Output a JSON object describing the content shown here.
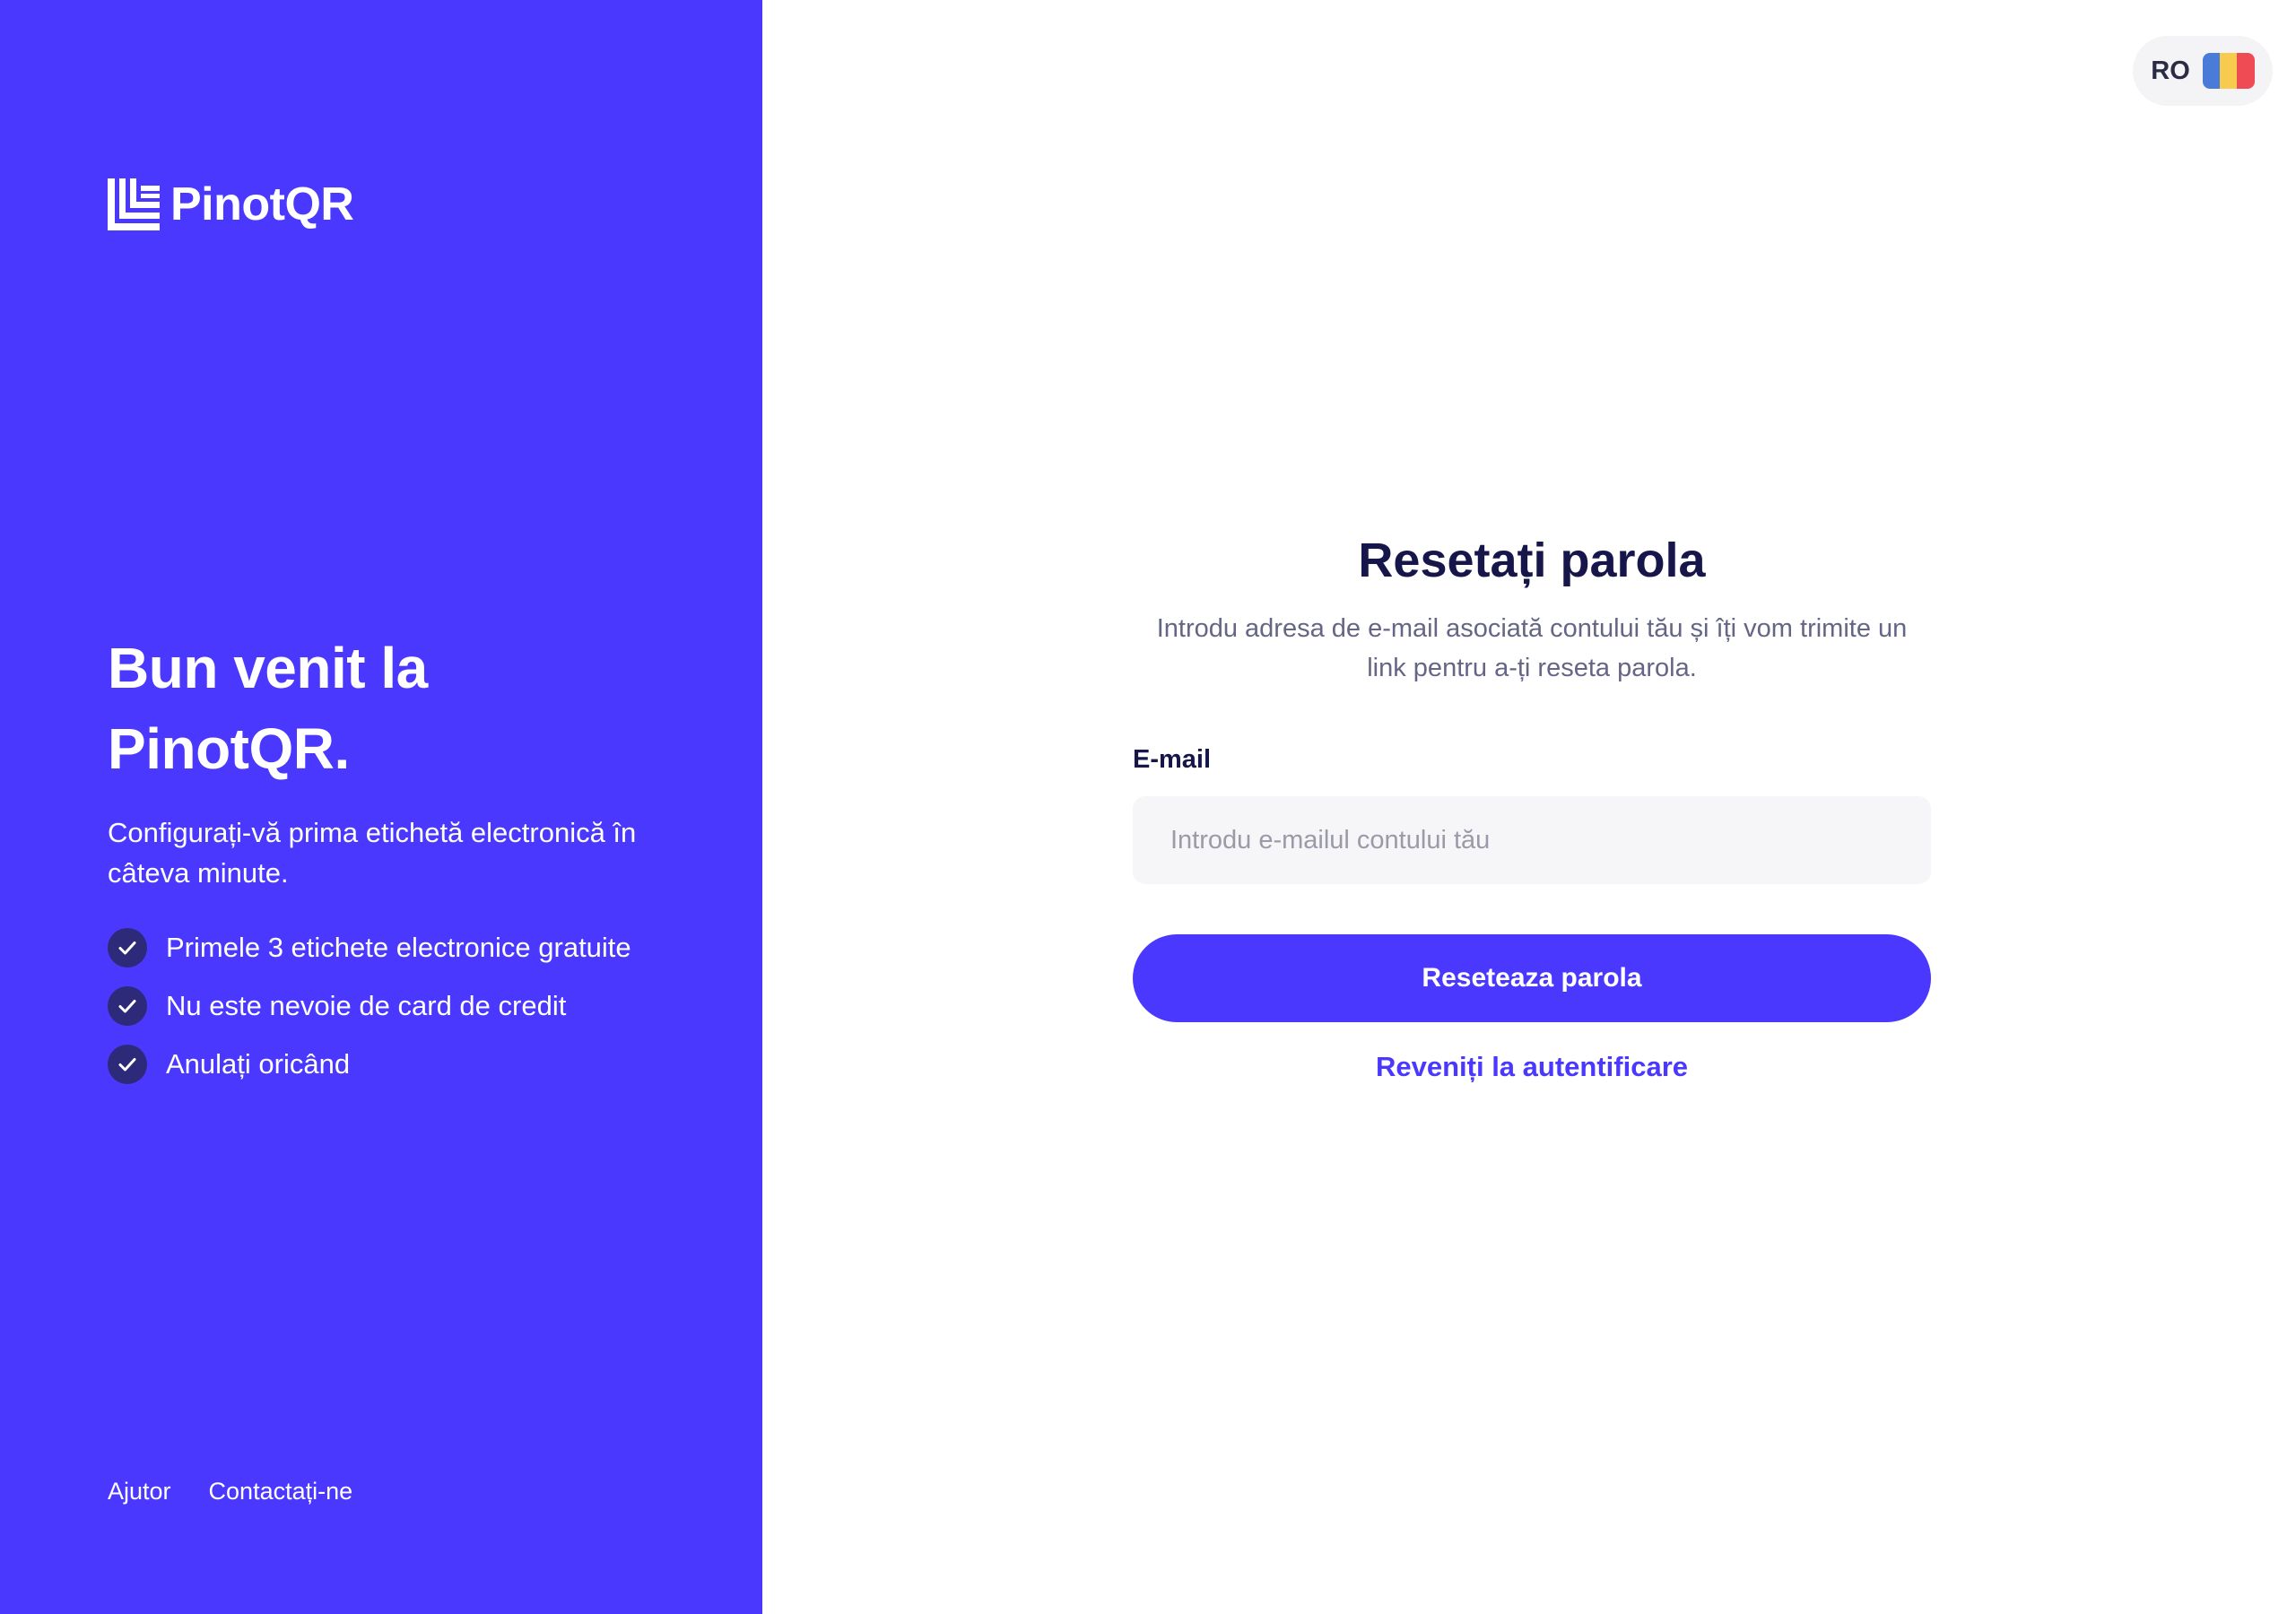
{
  "brand": {
    "name": "PinotQR",
    "accent_color": "#4a38fe",
    "logo_icon": "pinotqr-logo-icon"
  },
  "left_panel": {
    "welcome_title_line1": "Bun venit la",
    "welcome_title_line2": "PinotQR.",
    "subtitle": "Configurați-vă prima etichetă electronică în câteva minute.",
    "features": [
      {
        "icon": "check-icon",
        "label": "Primele 3 etichete electronice gratuite"
      },
      {
        "icon": "check-icon",
        "label": "Nu este nevoie de card de credit"
      },
      {
        "icon": "check-icon",
        "label": "Anulați oricând"
      }
    ],
    "footer_links": {
      "help": "Ajutor",
      "contact": "Contactați-ne"
    }
  },
  "language_selector": {
    "code": "RO",
    "flag_icon": "romania-flag-icon",
    "flag_colors": [
      "#4a7bd9",
      "#f7cb4d",
      "#ef4b55"
    ]
  },
  "form": {
    "title": "Resetați parola",
    "description": "Introdu adresa de e-mail asociată contului tău și îți vom trimite un link pentru a-ți reseta parola.",
    "email_label": "E-mail",
    "email_placeholder": "Introdu e-mailul contului tău",
    "email_value": "",
    "submit_label": "Reseteaza parola",
    "back_link": "Reveniți la autentificare"
  }
}
